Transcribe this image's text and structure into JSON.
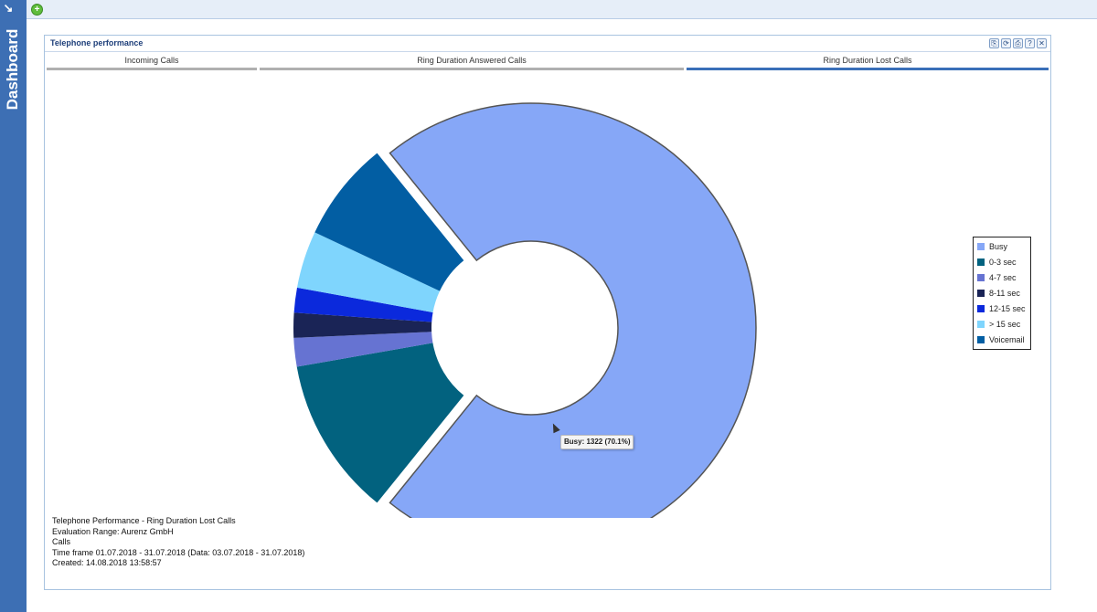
{
  "sidebar": {
    "title": "Dashboard",
    "arrow_icon": "arrow-icon"
  },
  "topbar": {
    "add_icon": "+"
  },
  "panel": {
    "title": "Telephone performance",
    "tools": [
      "⎘",
      "⟳",
      "⎙",
      "?",
      "✕"
    ]
  },
  "tabs": [
    {
      "label": "Incoming Calls",
      "active": false
    },
    {
      "label": "Ring Duration Answered Calls",
      "active": false
    },
    {
      "label": "Ring Duration Lost Calls",
      "active": true
    }
  ],
  "chart_data": {
    "type": "pie",
    "donut": true,
    "categories": [
      "Busy",
      "0-3 sec",
      "4-7 sec",
      "8-11 sec",
      "12-15 sec",
      "> 15 sec",
      "Voicemail"
    ],
    "values": [
      1322,
      211,
      38,
      33,
      33,
      76,
      133
    ],
    "percentages": [
      70.1,
      11.2,
      2.0,
      1.7,
      1.7,
      4.0,
      7.1
    ],
    "colors": [
      "#86a7f7",
      "#02627f",
      "#6673d2",
      "#1a2456",
      "#0b29dc",
      "#7fd5fd",
      "#025ea3"
    ],
    "exploded": [
      "Busy"
    ],
    "legend_position": "right"
  },
  "tooltip": {
    "text": "Busy: 1322 (70.1%)"
  },
  "info": {
    "line1": "Telephone Performance - Ring Duration Lost Calls",
    "line2": "Evaluation Range: Aurenz GmbH",
    "line3": "Calls",
    "line4": "Time frame 01.07.2018 - 31.07.2018 (Data: 03.07.2018 - 31.07.2018)",
    "line5": "Created: 14.08.2018 13:58:57"
  }
}
